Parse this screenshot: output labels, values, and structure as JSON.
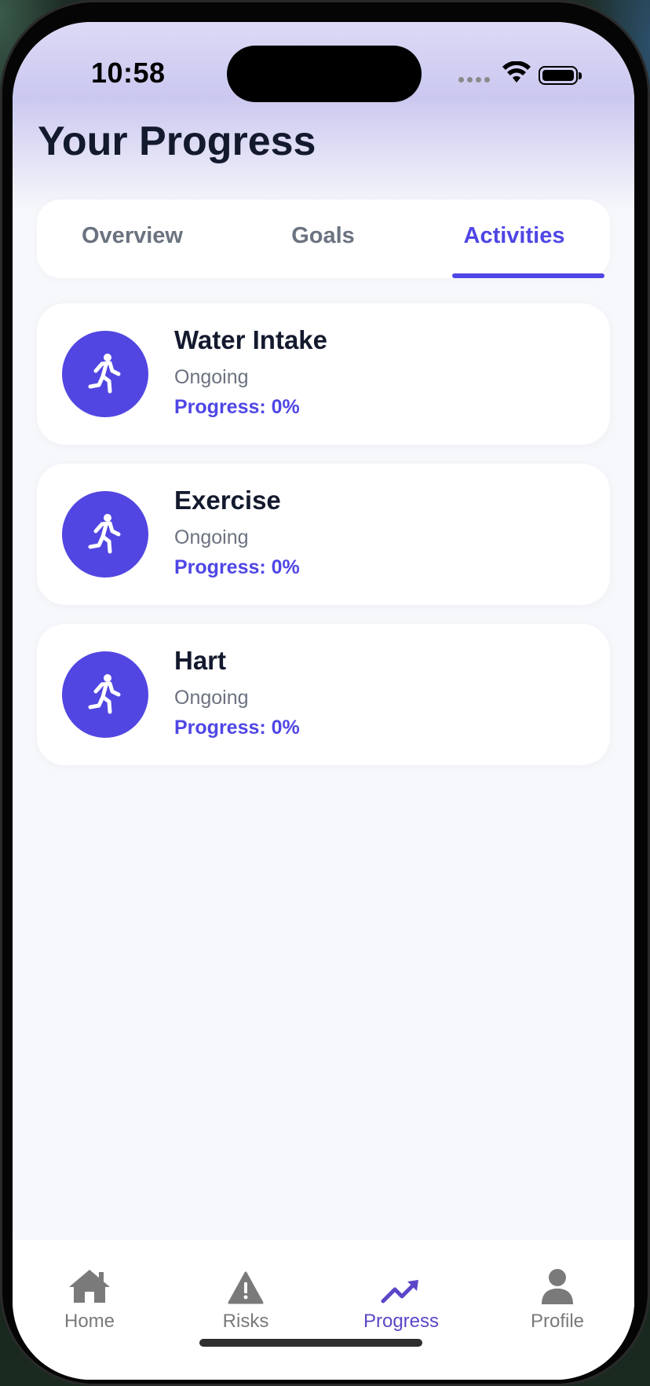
{
  "status_bar": {
    "time": "10:58"
  },
  "page": {
    "title": "Your Progress"
  },
  "tabs": [
    {
      "label": "Overview",
      "active": false
    },
    {
      "label": "Goals",
      "active": false
    },
    {
      "label": "Activities",
      "active": true
    }
  ],
  "activities": [
    {
      "title": "Water Intake",
      "status": "Ongoing",
      "progress": "Progress: 0%",
      "icon": "running-person-icon"
    },
    {
      "title": "Exercise",
      "status": "Ongoing",
      "progress": "Progress: 0%",
      "icon": "running-person-icon"
    },
    {
      "title": "Hart",
      "status": "Ongoing",
      "progress": "Progress: 0%",
      "icon": "running-person-icon"
    }
  ],
  "bottom_nav": [
    {
      "label": "Home",
      "icon": "home-icon",
      "active": false
    },
    {
      "label": "Risks",
      "icon": "warning-icon",
      "active": false
    },
    {
      "label": "Progress",
      "icon": "trending-up-icon",
      "active": true
    },
    {
      "label": "Profile",
      "icon": "person-icon",
      "active": false
    }
  ],
  "colors": {
    "accent": "#4f46e5",
    "text_dark": "#141a2e",
    "text_muted": "#6b7280",
    "nav_inactive": "#7a7a7a"
  }
}
